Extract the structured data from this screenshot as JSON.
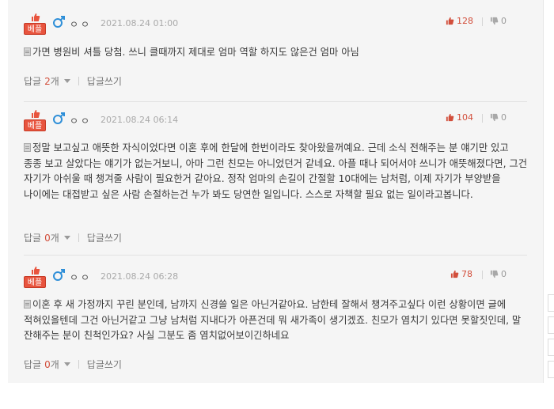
{
  "labels": {
    "best": "베플",
    "reply_label": "답글",
    "write_reply": "답글쓰기",
    "count_suffix": "개"
  },
  "colors": {
    "accent": "#e8543e",
    "male": "#2f8fd8"
  },
  "comments": [
    {
      "nickname": "ㅇㅇ",
      "date": "2021.08.24 01:00",
      "likes": "128",
      "dislikes": "0",
      "text": "가면 병원비 셔틀 당첨. 쓰니 클때까지 제대로 엄마 역할 하지도 않은건 엄마 아님",
      "reply_count": "2"
    },
    {
      "nickname": "ㅇㅇ",
      "date": "2021.08.24 06:14",
      "likes": "104",
      "dislikes": "0",
      "text": "정말 보고싶고 애뜻한 자식이었다면 이혼 후에 한달에 한번이라도 찾아왔을꺼예요. 근데 소식 전해주는 분 얘기만 있고 종종 보고 살았다는 얘기가 없는거보니, 아마 그런 친모는 아니었던거 같네요. 아플 때나 되어서야 쓰니가 애뜻해졌다면, 그건 자기가 아쉬울 때 챙겨줄 사람이 필요한거 같아요. 정작 엄마의 손길이 간절할 10대에는 남처럼, 이제 자기가 부양받을 나이에는 대접받고 싶은 사람 손절하는건 누가 봐도 당연한 일입니다. 스스로 자책할 필요 없는 일이라고봅니다.",
      "reply_count": "0"
    },
    {
      "nickname": "ㅇㅇ",
      "date": "2021.08.24 06:28",
      "likes": "78",
      "dislikes": "0",
      "text": "이혼 후 새 가정까지 꾸린 분인데, 남까지 신경쓸 일은 아닌거같아요. 남한테 잘해서 챙겨주고싶다 이런 상황이면 글에 적혀있을텐데 그건 아닌거같고 그냥 남처럼 지내다가 아픈건데 뭐 새가족이 생기겠죠. 친모가 염치기 있다면 못할짓인데, 말 잔해주는 분이 친척인가요? 사실 그분도 좀 염치없어보이긴하네요",
      "reply_count": "0"
    }
  ]
}
